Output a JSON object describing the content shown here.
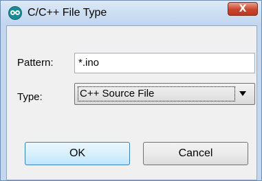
{
  "window": {
    "title": "C/C++ File Type",
    "close_label": "X"
  },
  "form": {
    "pattern_label": "Pattern:",
    "pattern_value": "*.ino",
    "type_label": "Type:",
    "type_selected": "C++ Source File"
  },
  "buttons": {
    "ok_label": "OK",
    "cancel_label": "Cancel"
  },
  "icons": {
    "app": "arduino-logo-icon",
    "close": "close-icon",
    "dropdown": "chevron-down-icon"
  }
}
